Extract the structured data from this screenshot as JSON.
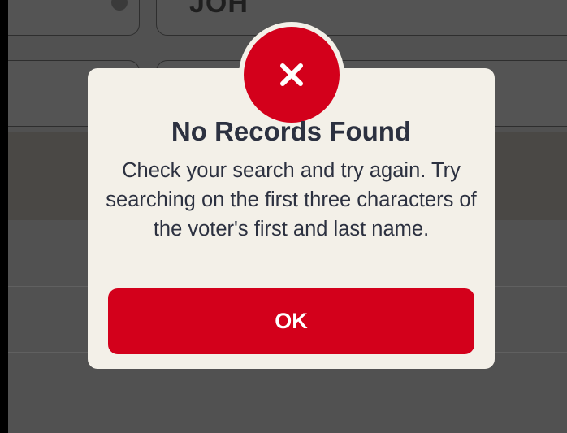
{
  "background_form": {
    "field_value": "JOH"
  },
  "alert": {
    "icon": "close-icon",
    "title": "No Records Found",
    "message": "Check your search and try again. Try searching on the first three characters of the voter's first and last name.",
    "ok_label": "OK"
  },
  "colors": {
    "accent": "#d3001b",
    "alert_background": "#f3f0e8",
    "text": "#2c3140",
    "overlay": "#515151"
  }
}
